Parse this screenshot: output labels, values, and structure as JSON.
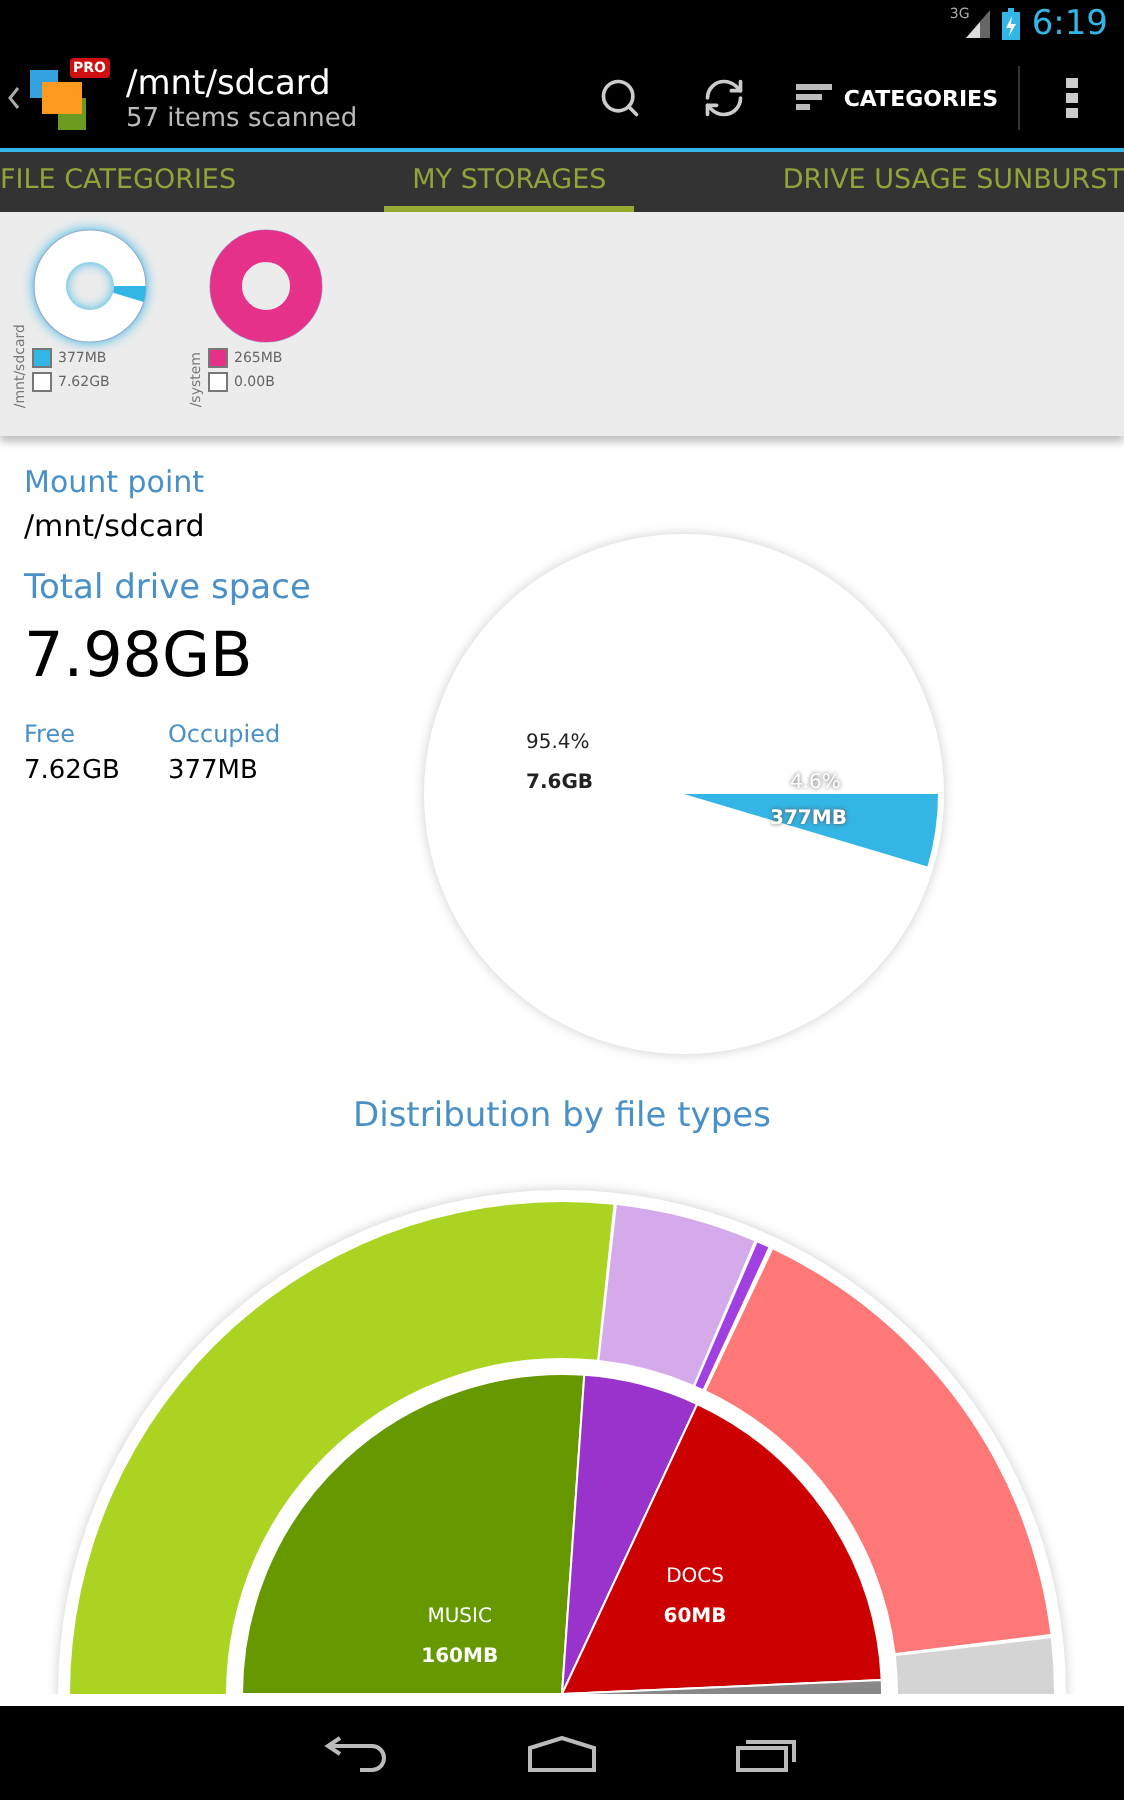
{
  "status_bar": {
    "network": "3G",
    "time": "6:19"
  },
  "action_bar": {
    "badge": "PRO",
    "title": "/mnt/sdcard",
    "subtitle": "57 items scanned",
    "categories_label": "CATEGORIES"
  },
  "tabs": [
    {
      "label": "FILE CATEGORIES",
      "selected": false
    },
    {
      "label": "MY STORAGES",
      "selected": true
    },
    {
      "label": "DRIVE USAGE SUNBURST",
      "selected": false
    }
  ],
  "storages": [
    {
      "name": "/mnt/sdcard",
      "selected": true,
      "color": "#33b5e5",
      "used": "377MB",
      "free": "7.62GB"
    },
    {
      "name": "/system",
      "selected": false,
      "color": "#e5318a",
      "used": "265MB",
      "free": "0.00B"
    }
  ],
  "details": {
    "mount_label": "Mount point",
    "mount_value": "/mnt/sdcard",
    "total_label": "Total drive space",
    "total_value": "7.98GB",
    "free_label": "Free",
    "free_value": "7.62GB",
    "occupied_label": "Occupied",
    "occupied_value": "377MB"
  },
  "usage_pie": {
    "free_percent": "95.4%",
    "free_size": "7.6GB",
    "used_percent": "4.6%",
    "used_size": "377MB"
  },
  "distribution": {
    "title": "Distribution by file types",
    "inner": [
      {
        "label": "MUSIC",
        "size": "160MB",
        "color": "#669900"
      },
      {
        "color": "#9933cc"
      },
      {
        "label": "DOCS",
        "size": "60MB",
        "color": "#cc0000"
      },
      {
        "color": "#888888"
      }
    ],
    "outer": [
      {
        "color": "#aad322"
      },
      {
        "color": "#d4aaea"
      },
      {
        "color": "#a040e0"
      },
      {
        "color": "#ff7878"
      },
      {
        "color": "#d4d4d4"
      }
    ]
  }
}
